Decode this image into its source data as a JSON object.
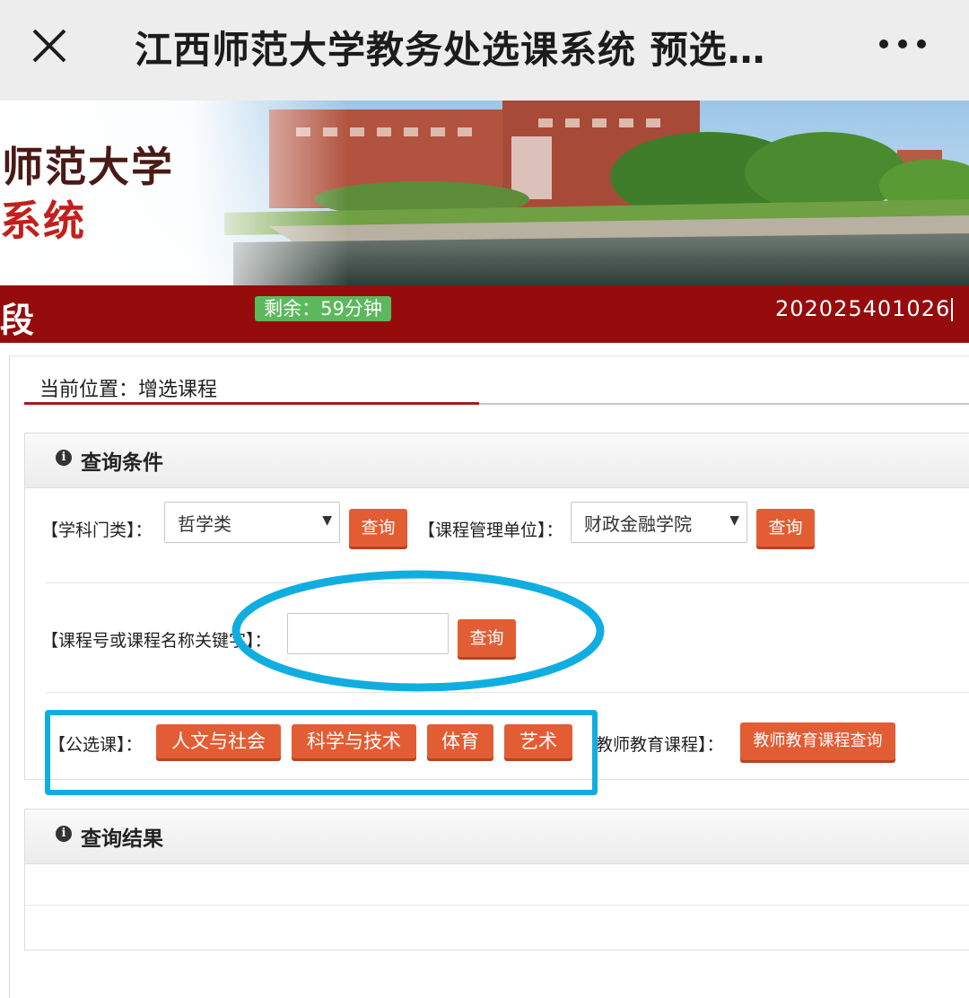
{
  "appbar": {
    "title": "江西师范大学教务处选课系统 预选…",
    "close_icon": "close-icon",
    "more_icon": "more-icon"
  },
  "banner": {
    "logo_line1": "师范大学",
    "logo_line2": "系统"
  },
  "status": {
    "stage_char": "段",
    "timer": "剩余：59分钟",
    "student_id": "202025401026"
  },
  "breadcrumb": "当前位置：增选课程",
  "query_panel": {
    "title": "查询条件",
    "subject_label": "【学科门类】：",
    "subject_value": "哲学类",
    "query_button": "查询",
    "unit_label": "【课程管理单位】：",
    "unit_value": "财政金融学院",
    "keyword_label": "【课程号或课程名称关键字】：",
    "keyword_value": "",
    "public_label": "【公选课】：",
    "public_buttons": [
      "人文与社会",
      "科学与技术",
      "体育",
      "艺术"
    ],
    "teacher_label": "教师教育课程】：",
    "teacher_button": "教师教育课程查询"
  },
  "result_panel": {
    "title": "查询结果"
  },
  "colors": {
    "status_bar": "#960c0c",
    "button": "#e35d34",
    "timer_badge": "#5cb85c",
    "annotation": "#10aee0"
  }
}
